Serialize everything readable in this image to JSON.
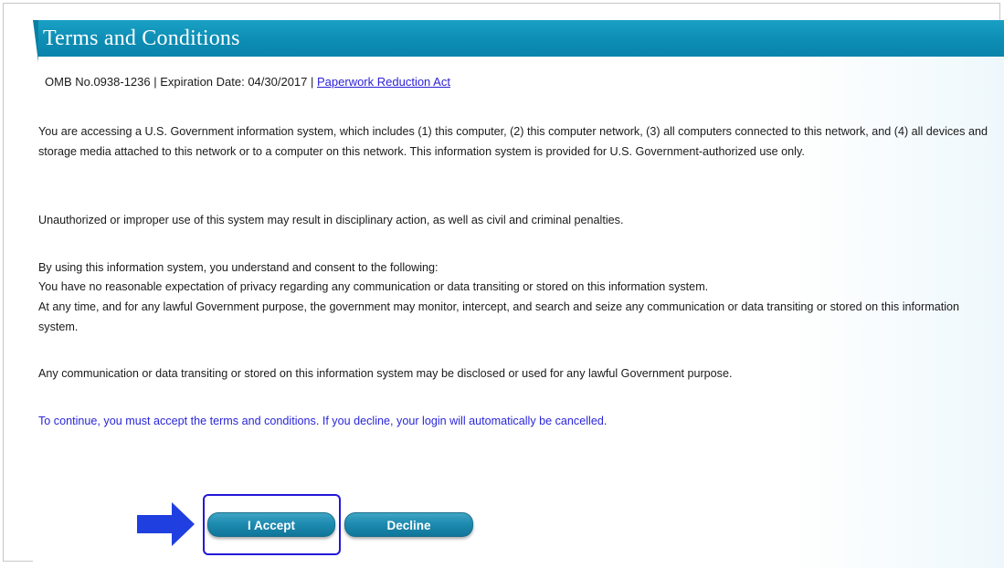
{
  "title": "Terms and Conditions",
  "omb": {
    "number_text": "OMB No.0938-1236 |  Expiration Date: 04/30/2017 | ",
    "link_text": "Paperwork Reduction Act"
  },
  "paragraphs": [
    "You are accessing a U.S. Government information system, which includes (1) this computer, (2) this computer network, (3) all computers connected to this network, and (4) all devices and storage media attached to this network or to a computer on this network. This information system is provided for U.S. Government-authorized use only.",
    "Unauthorized or improper use of this system may result in disciplinary action, as well as civil and criminal penalties.",
    "By using this information system, you understand and consent to the following:",
    "You have no reasonable expectation of privacy regarding any communication or data transiting or stored on this information system.",
    "At any time, and for any lawful Government purpose, the government may monitor, intercept, and search and seize any communication or data transiting or stored on this information system.",
    "Any communication or data transiting or stored on this information system may be disclosed or used for any lawful Government purpose."
  ],
  "continue_notice": "To continue, you must accept the terms and conditions. If you decline, your login will automatically be cancelled.",
  "buttons": {
    "accept_label": "I Accept",
    "decline_label": "Decline"
  },
  "colors": {
    "header": "#0c8cb3",
    "notice_text": "#2a26d9",
    "highlight": "#2417d9",
    "arrow": "#1f3fe0"
  },
  "icons": {
    "pointer": "right-arrow-icon"
  }
}
